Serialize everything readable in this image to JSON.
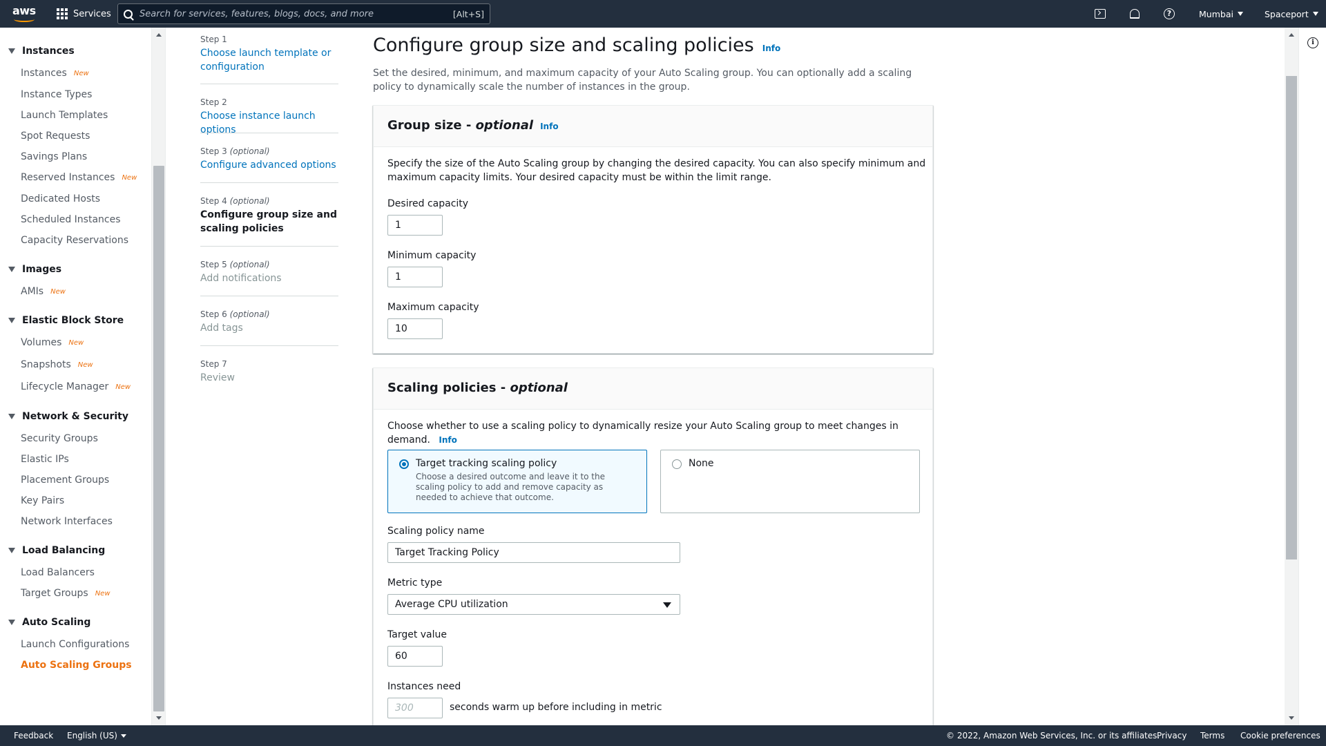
{
  "topnav": {
    "logo_text": "aws",
    "services_label": "Services",
    "search_placeholder": "Search for services, features, blogs, docs, and more",
    "search_shortcut": "[Alt+S]",
    "region": "Mumbai",
    "account": "Spaceport"
  },
  "sidebar": {
    "groups": [
      {
        "title": "Instances",
        "items": [
          {
            "label": "Instances",
            "badge": "New"
          },
          {
            "label": "Instance Types"
          },
          {
            "label": "Launch Templates"
          },
          {
            "label": "Spot Requests"
          },
          {
            "label": "Savings Plans"
          },
          {
            "label": "Reserved Instances",
            "badge": "New"
          },
          {
            "label": "Dedicated Hosts"
          },
          {
            "label": "Scheduled Instances"
          },
          {
            "label": "Capacity Reservations"
          }
        ]
      },
      {
        "title": "Images",
        "items": [
          {
            "label": "AMIs",
            "badge": "New"
          }
        ]
      },
      {
        "title": "Elastic Block Store",
        "items": [
          {
            "label": "Volumes",
            "badge": "New"
          },
          {
            "label": "Snapshots",
            "badge": "New"
          },
          {
            "label": "Lifecycle Manager",
            "badge": "New"
          }
        ]
      },
      {
        "title": "Network & Security",
        "items": [
          {
            "label": "Security Groups"
          },
          {
            "label": "Elastic IPs"
          },
          {
            "label": "Placement Groups"
          },
          {
            "label": "Key Pairs"
          },
          {
            "label": "Network Interfaces"
          }
        ]
      },
      {
        "title": "Load Balancing",
        "items": [
          {
            "label": "Load Balancers"
          },
          {
            "label": "Target Groups",
            "badge": "New"
          }
        ]
      },
      {
        "title": "Auto Scaling",
        "items": [
          {
            "label": "Launch Configurations"
          },
          {
            "label": "Auto Scaling Groups",
            "active": true
          }
        ]
      }
    ]
  },
  "steps": [
    {
      "label": "Step 1",
      "optional": "",
      "name": "Choose launch template or configuration",
      "state": "link"
    },
    {
      "label": "Step 2",
      "optional": "",
      "name": "Choose instance launch options",
      "state": "link"
    },
    {
      "label": "Step 3",
      "optional": "(optional)",
      "name": "Configure advanced options",
      "state": "link"
    },
    {
      "label": "Step 4",
      "optional": "(optional)",
      "name": "Configure group size and scaling policies",
      "state": "current"
    },
    {
      "label": "Step 5",
      "optional": "(optional)",
      "name": "Add notifications",
      "state": "disabled"
    },
    {
      "label": "Step 6",
      "optional": "(optional)",
      "name": "Add tags",
      "state": "disabled"
    },
    {
      "label": "Step 7",
      "optional": "",
      "name": "Review",
      "state": "disabled"
    }
  ],
  "main": {
    "title": "Configure group size and scaling policies",
    "info": "Info",
    "description": "Set the desired, minimum, and maximum capacity of your Auto Scaling group. You can optionally add a scaling policy to dynamically scale the number of instances in the group.",
    "group_size": {
      "title": "Group size - ",
      "title_optional": "optional",
      "info": "Info",
      "description": "Specify the size of the Auto Scaling group by changing the desired capacity. You can also specify minimum and maximum capacity limits. Your desired capacity must be within the limit range.",
      "desired_label": "Desired capacity",
      "desired_value": "1",
      "min_label": "Minimum capacity",
      "min_value": "1",
      "max_label": "Maximum capacity",
      "max_value": "10"
    },
    "scaling": {
      "title": "Scaling policies - ",
      "title_optional": "optional",
      "description": "Choose whether to use a scaling policy to dynamically resize your Auto Scaling group to meet changes in demand.",
      "info": "Info",
      "option_target_title": "Target tracking scaling policy",
      "option_target_desc": "Choose a desired outcome and leave it to the scaling policy to add and remove capacity as needed to achieve that outcome.",
      "option_none_title": "None",
      "policy_name_label": "Scaling policy name",
      "policy_name_value": "Target Tracking Policy",
      "metric_label": "Metric type",
      "metric_value": "Average CPU utilization",
      "target_label": "Target value",
      "target_value": "60",
      "warmup_label": "Instances need",
      "warmup_placeholder": "300",
      "warmup_suffix": "seconds warm up before including in metric"
    }
  },
  "footer": {
    "feedback": "Feedback",
    "language": "English (US)",
    "copyright": "© 2022, Amazon Web Services, Inc. or its affiliates.",
    "privacy": "Privacy",
    "terms": "Terms",
    "cookies": "Cookie preferences"
  }
}
